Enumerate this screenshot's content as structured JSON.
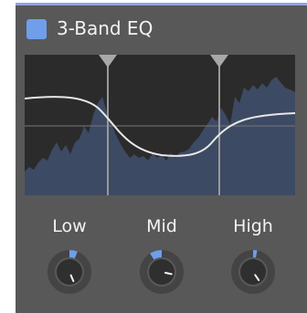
{
  "header": {
    "title": "3-Band EQ",
    "enabled": true
  },
  "bands": [
    {
      "label": "Low",
      "value": 0.58
    },
    {
      "label": "Mid",
      "value": 0.38
    },
    {
      "label": "High",
      "value": 0.54
    }
  ],
  "colors": {
    "accent": "#6f9eea",
    "panel": "#585858",
    "graph_bg": "#2b2b2b",
    "spectrum": "#3d4a63",
    "curve": "#e8e8e8"
  }
}
